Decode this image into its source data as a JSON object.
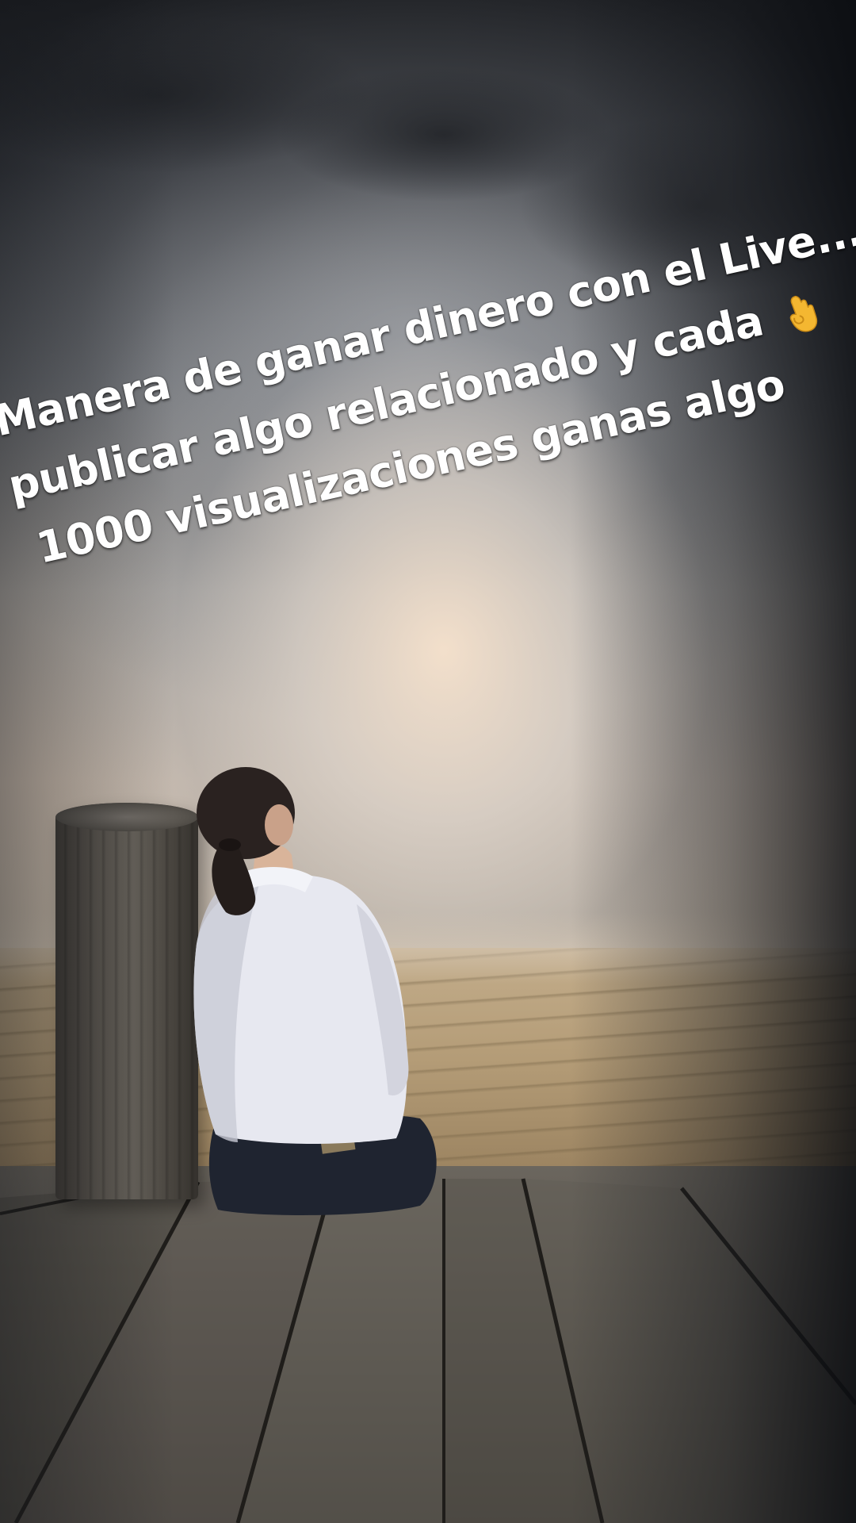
{
  "caption": {
    "line1": "Manera de ganar dinero con el Live...",
    "line2": "publicar algo relacionado y cada",
    "line3": "1000 visualizaciones ganas algo"
  },
  "icons": {
    "emoji": "ok-hand-icon"
  },
  "colors": {
    "caption_text": "#ffffff",
    "emoji_fill": "#f4b731",
    "sky_glow": "#e8d7c4",
    "sea": "#b49c77",
    "dock": "#56514a"
  }
}
